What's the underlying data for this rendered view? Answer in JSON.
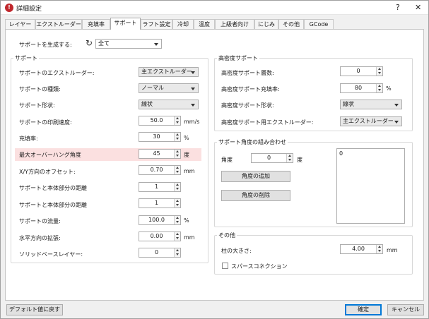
{
  "window": {
    "title": "詳細設定",
    "help": "?",
    "close": "✕"
  },
  "tabs": [
    "レイヤー",
    "エクストルーダー",
    "充填率",
    "サポート",
    "ラフト設定",
    "冷却",
    "温度",
    "上級者向け",
    "にじみ",
    "その他",
    "GCode"
  ],
  "generate": {
    "label": "サポートを生成する:",
    "value": "全て"
  },
  "support": {
    "title": "サポート",
    "extruder_label": "サポートのエクストルーダー:",
    "extruder_value": "主エクストルーダー",
    "type_label": "サポートの種類:",
    "type_value": "ノーマル",
    "shape_label": "サポート形状:",
    "shape_value": "線状",
    "speed_label": "サポートの印刷速度:",
    "speed_value": "50.0",
    "speed_unit": "mm/s",
    "fill_label": "充填率:",
    "fill_value": "30",
    "fill_unit": "%",
    "overhang_label": "最大オーバーハング角度",
    "overhang_value": "45",
    "overhang_unit": "度",
    "xy_label": "X/Y方向のオフセット:",
    "xy_value": "0.70",
    "xy_unit": "mm",
    "dist1_label": "サポートと本体部分の距離",
    "dist1_value": "1",
    "dist2_label": "サポートと本体部分の距離",
    "dist2_value": "1",
    "flow_label": "サポートの流量:",
    "flow_value": "100.0",
    "flow_unit": "%",
    "horiz_label": "水平方向の拡張:",
    "horiz_value": "0.00",
    "horiz_unit": "mm",
    "solid_label": "ソリッドベースレイヤー:",
    "solid_value": "0"
  },
  "dense": {
    "title": "高密度サポート",
    "layers_label": "高密度サポート層数:",
    "layers_value": "0",
    "fill_label": "高密度サポート充填率:",
    "fill_value": "80",
    "fill_unit": "%",
    "shape_label": "高密度サポート形状:",
    "shape_value": "線状",
    "extruder_label": "高密度サポート用エクストルーダー:",
    "extruder_value": "主エクストルーダー"
  },
  "angles": {
    "title": "サポート角度の組み合わせ",
    "angle_label": "角度",
    "angle_value": "0",
    "angle_unit": "度",
    "add_button": "角度の追加",
    "remove_button": "角度の削除",
    "list_items": [
      "0"
    ]
  },
  "other": {
    "title": "その他",
    "pillar_label": "柱の大きさ:",
    "pillar_value": "4.00",
    "pillar_unit": "mm",
    "bridge_label": "スパースコネクション"
  },
  "footer": {
    "reset_button": "デフォルト値に戻す",
    "ok_button": "確定",
    "cancel_button": "キャンセル"
  }
}
